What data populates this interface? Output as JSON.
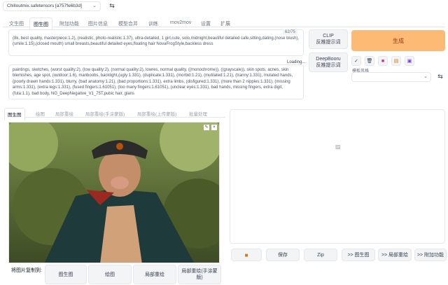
{
  "checkpoint": {
    "value": "Chilloutmix.safetensors [a757fe6b3d]",
    "swap_icon": "swap-icon"
  },
  "tabs": [
    "文生图",
    "图生图",
    "附加功能",
    "图片信息",
    "模型合并",
    "训练",
    "mov2mov",
    "设置",
    "扩展"
  ],
  "active_tab": 1,
  "prompt": {
    "text": "(8k, best quality, masterpiece:1.2), (realistic, photo-realistic:1.37), ultra-detailed, 1 girl,cute, solo,midnight,beautiful detailed cafe,sitting,dating,(nose blush),(smile:1.15),(closed mouth) small breasts,beautiful detailed eyes,floating hair NovaFrogStyle,backless dress",
    "counter": "62/75"
  },
  "negative": {
    "text": "paintings, sketches, (worst quality:2), (low quality:2), (normal quality:2), lowres, normal quality, ((monochrome)), ((grayscale)), skin spots, acnes, skin blemishes, age spot, (outdoor:1.6), manboobs, backlight,(ugly:1.331), (duplicate:1.331), (morbid:1.21), (mutilated:1.21), (tranny:1.331), mutated hands, (poorly drawn hands:1.331), blurry, (bad anatomy:1.21), (bad proportions:1.331), extra limbs, (disfigured:1.331), (more than 2 nipples:1.331), (missing arms:1.331), (extra legs:1.331), (fused fingers:1.61051), (too many fingers:1.61051), (unclear eyes:1.331), bad hands, missing fingers, extra digit, (futa:1.1), bad body, NG_DeepNegative_V1_75T,pubic hair, glans",
    "loading": "Loading..."
  },
  "interrogate": {
    "clip": [
      "CLIP",
      "反推提示词"
    ],
    "deepbooru": [
      "DeepBooru",
      "反推提示词"
    ]
  },
  "generate": {
    "label": "生成",
    "color": "#fdba74"
  },
  "style": {
    "label": "模板风格",
    "tools": [
      "check-icon",
      "trash-icon",
      "book-icon",
      "clipboard-icon",
      "save-icon"
    ]
  },
  "subtabs": [
    "图生图",
    "绘图",
    "局部重绘",
    "局部重绘(手涂蒙版)",
    "局部重绘(上传蒙版)",
    "批量处理"
  ],
  "copy_to": {
    "label": "将图片复制到:",
    "buttons": [
      "图生图",
      "绘图",
      "局部重绘",
      "局部重绘(手涂蒙版)"
    ]
  },
  "output_buttons": [
    "folder-icon",
    "保存",
    "Zip",
    ">> 图生图",
    ">> 局部重绘",
    ">> 附加功能"
  ]
}
